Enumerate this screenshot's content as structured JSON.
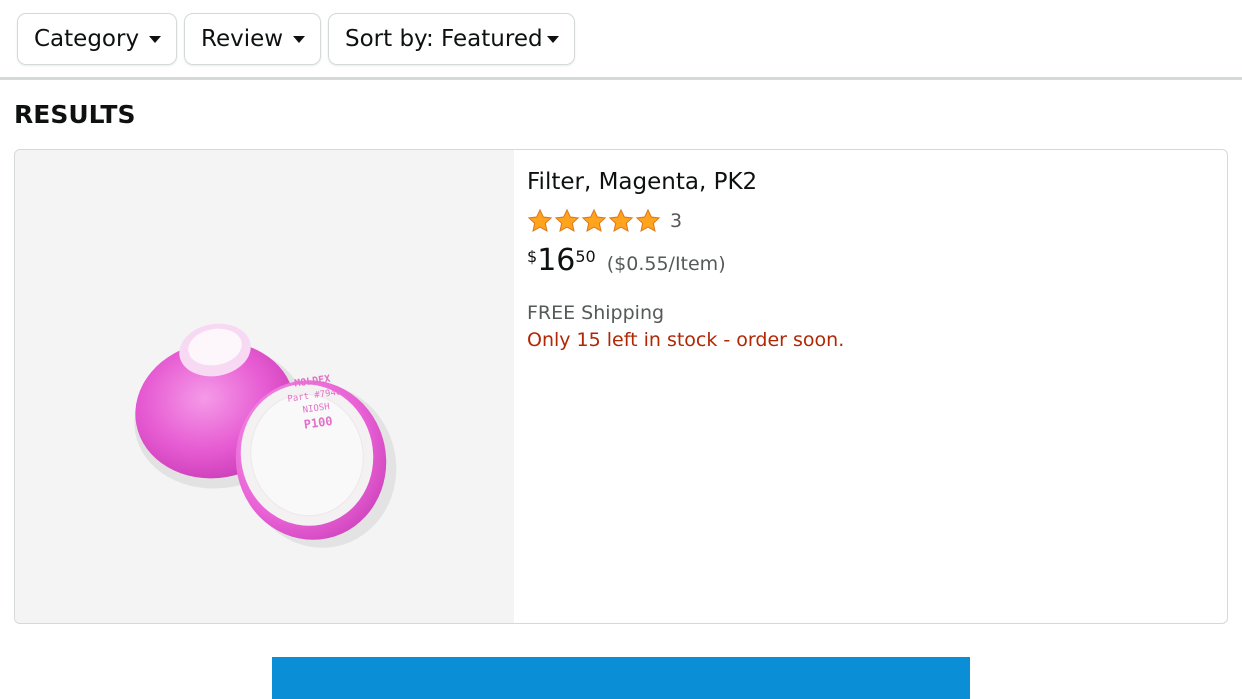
{
  "filters": {
    "category_label": "Category",
    "review_label": "Review",
    "sort_label": "Sort by: Featured"
  },
  "results": {
    "heading": "RESULTS",
    "items": [
      {
        "title": "Filter, Magenta, PK2",
        "rating_stars": 5,
        "rating_count": "3",
        "price_symbol": "$",
        "price_whole": "16",
        "price_fraction": "50",
        "unit_price": "($0.55/Item)",
        "shipping": "FREE Shipping",
        "stock": "Only 15 left in stock - order soon.",
        "image_text": {
          "brand": "MOLDEX",
          "part": "Part #7940",
          "cert": "NIOSH",
          "rating": "P100"
        }
      }
    ]
  },
  "colors": {
    "stock_red": "#b12704",
    "star_gold": "#ffa41c",
    "filter_magenta": "#e75bd4",
    "cta_blue": "#0a8fd6"
  },
  "icons": {
    "dropdown": "caret-down-icon",
    "star": "star-icon"
  }
}
